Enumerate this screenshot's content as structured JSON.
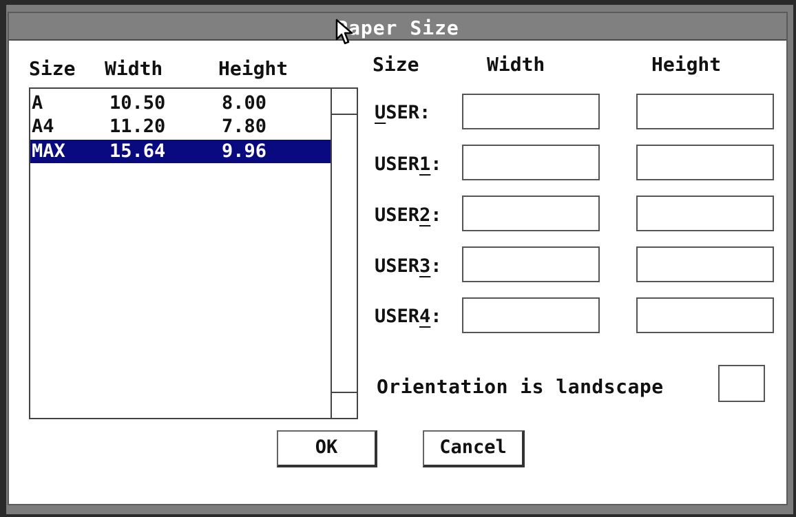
{
  "dialog": {
    "title": "Paper Size"
  },
  "list": {
    "headers": {
      "size": "Size",
      "width": "Width",
      "height": "Height"
    },
    "rows": [
      {
        "size": "A",
        "width": "10.50",
        "height": "8.00",
        "selected": false
      },
      {
        "size": "A4",
        "width": "11.20",
        "height": "7.80",
        "selected": false
      },
      {
        "size": "MAX",
        "width": "15.64",
        "height": "9.96",
        "selected": true
      }
    ]
  },
  "custom": {
    "headers": {
      "size": "Size",
      "width": "Width",
      "height": "Height"
    },
    "rows": [
      {
        "label_pre": "",
        "label_key": "U",
        "label_post": "SER:",
        "width": "",
        "height": ""
      },
      {
        "label_pre": "USER",
        "label_key": "1",
        "label_post": ":",
        "width": "",
        "height": ""
      },
      {
        "label_pre": "USER",
        "label_key": "2",
        "label_post": ":",
        "width": "",
        "height": ""
      },
      {
        "label_pre": "USER",
        "label_key": "3",
        "label_post": ":",
        "width": "",
        "height": ""
      },
      {
        "label_pre": "USER",
        "label_key": "4",
        "label_post": ":",
        "width": "",
        "height": ""
      }
    ]
  },
  "orientation": {
    "label": "Orientation is landscape",
    "checked": false
  },
  "buttons": {
    "ok": "OK",
    "cancel": "Cancel"
  },
  "colors": {
    "selection": "#0a0a80",
    "titlebar": "#808080"
  },
  "icons": {
    "cursor": "mouse-pointer-icon"
  }
}
